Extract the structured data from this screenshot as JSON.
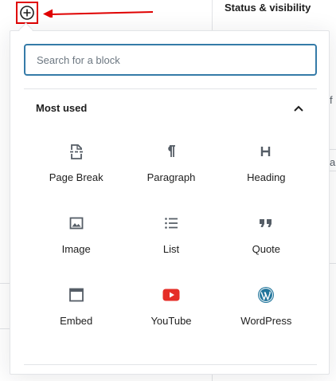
{
  "sidebar": {
    "title": "Status & visibility"
  },
  "inserter": {
    "toggle_icon": "plus-circle-icon",
    "search": {
      "placeholder": "Search for a block",
      "value": ""
    },
    "panel": {
      "title": "Most used",
      "expanded": true,
      "blocks": [
        {
          "label": "Page Break",
          "icon": "page-break-icon"
        },
        {
          "label": "Paragraph",
          "icon": "paragraph-icon"
        },
        {
          "label": "Heading",
          "icon": "heading-icon"
        },
        {
          "label": "Image",
          "icon": "image-icon"
        },
        {
          "label": "List",
          "icon": "list-icon"
        },
        {
          "label": "Quote",
          "icon": "quote-icon"
        },
        {
          "label": "Embed",
          "icon": "embed-icon"
        },
        {
          "label": "YouTube",
          "icon": "youtube-icon"
        },
        {
          "label": "WordPress",
          "icon": "wordpress-icon"
        }
      ]
    }
  },
  "colors": {
    "highlight": "#e00000",
    "focus_border": "#357ba8",
    "youtube_red": "#e52d27",
    "wordpress_blue": "#21759b",
    "icon": "#555d66"
  }
}
